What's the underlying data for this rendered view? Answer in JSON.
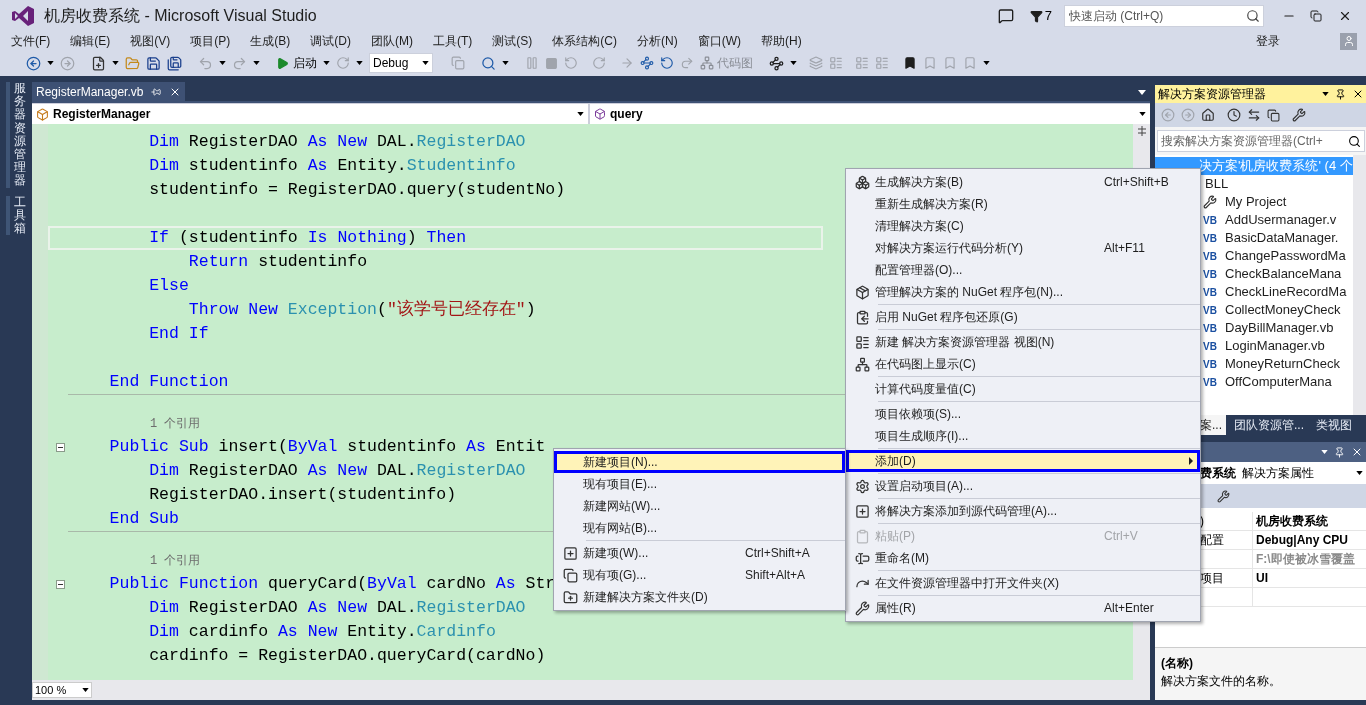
{
  "window": {
    "title": "机房收费系统 - Microsoft Visual Studio",
    "notification_count": "7",
    "quick_launch": {
      "placeholder": "快速启动 (Ctrl+Q)"
    }
  },
  "menu_bar": {
    "items": [
      "文件(F)",
      "编辑(E)",
      "视图(V)",
      "项目(P)",
      "生成(B)",
      "调试(D)",
      "团队(M)",
      "工具(T)",
      "测试(S)",
      "体系结构(C)",
      "分析(N)",
      "窗口(W)",
      "帮助(H)"
    ],
    "sign_in": "登录"
  },
  "toolbar": {
    "start": "启动",
    "configuration": "Debug",
    "code_map": "代码图"
  },
  "side_tabs": [
    "服务器资源管理器",
    "工具箱"
  ],
  "editor": {
    "tabs": [
      {
        "label": "RegisterManager.vb",
        "selected": true
      }
    ],
    "type_selector": "RegisterManager",
    "member_selector": "query",
    "zoom": "100 %",
    "lines": [
      {
        "kind": "code",
        "current": false,
        "fold": false,
        "tokens": [
          {
            "t": "        Dim ",
            "kind": "kw"
          },
          {
            "t": "RegisterDAO ",
            "kind": "p"
          },
          {
            "t": "As New ",
            "kind": "kw"
          },
          {
            "t": "DAL.",
            "kind": "p"
          },
          {
            "t": "RegisterDAO",
            "kind": "ty"
          }
        ]
      },
      {
        "kind": "code",
        "current": false,
        "fold": false,
        "tokens": [
          {
            "t": "        Dim ",
            "kind": "kw"
          },
          {
            "t": "studentinfo ",
            "kind": "p"
          },
          {
            "t": "As ",
            "kind": "kw"
          },
          {
            "t": "Entity.",
            "kind": "p"
          },
          {
            "t": "Studentinfo",
            "kind": "ty"
          }
        ]
      },
      {
        "kind": "code",
        "current": false,
        "fold": false,
        "tokens": [
          {
            "t": "        studentinfo = RegisterDAO.query(studentNo)",
            "kind": "p"
          }
        ]
      },
      {
        "kind": "blank"
      },
      {
        "kind": "code",
        "current": true,
        "fold": false,
        "tokens": [
          {
            "t": "        If ",
            "kind": "kw"
          },
          {
            "t": "(studentinfo ",
            "kind": "p"
          },
          {
            "t": "Is Nothing",
            "kind": "kw"
          },
          {
            "t": ") ",
            "kind": "p"
          },
          {
            "t": "Then",
            "kind": "kw"
          }
        ]
      },
      {
        "kind": "code",
        "current": false,
        "fold": false,
        "tokens": [
          {
            "t": "            Return ",
            "kind": "kw"
          },
          {
            "t": "studentinfo",
            "kind": "p"
          }
        ]
      },
      {
        "kind": "code",
        "current": false,
        "fold": false,
        "tokens": [
          {
            "t": "        Else",
            "kind": "kw"
          }
        ]
      },
      {
        "kind": "code",
        "current": false,
        "fold": false,
        "tokens": [
          {
            "t": "            Throw New ",
            "kind": "kw"
          },
          {
            "t": "Exception",
            "kind": "ty"
          },
          {
            "t": "(",
            "kind": "p"
          },
          {
            "t": "\"该学号已经存在\"",
            "kind": "str"
          },
          {
            "t": ")",
            "kind": "p"
          }
        ]
      },
      {
        "kind": "code",
        "current": false,
        "fold": false,
        "tokens": [
          {
            "t": "        End If",
            "kind": "kw"
          }
        ]
      },
      {
        "kind": "blank"
      },
      {
        "kind": "code",
        "current": false,
        "fold": false,
        "tokens": [
          {
            "t": "    End Function",
            "kind": "kw"
          }
        ]
      },
      {
        "kind": "separator"
      },
      {
        "kind": "lens",
        "text": "1 个引用"
      },
      {
        "kind": "code",
        "current": false,
        "fold": true,
        "tokens": [
          {
            "t": "    Public Sub ",
            "kind": "kw"
          },
          {
            "t": "insert(",
            "kind": "p"
          },
          {
            "t": "ByVal ",
            "kind": "kw"
          },
          {
            "t": "studentinfo ",
            "kind": "p"
          },
          {
            "t": "As ",
            "kind": "kw"
          },
          {
            "t": "Entit",
            "kind": "p"
          }
        ]
      },
      {
        "kind": "code",
        "current": false,
        "fold": false,
        "tokens": [
          {
            "t": "        Dim ",
            "kind": "kw"
          },
          {
            "t": "RegisterDAO ",
            "kind": "p"
          },
          {
            "t": "As New ",
            "kind": "kw"
          },
          {
            "t": "DAL.",
            "kind": "p"
          },
          {
            "t": "RegisterDAO",
            "kind": "ty"
          }
        ]
      },
      {
        "kind": "code",
        "current": false,
        "fold": false,
        "tokens": [
          {
            "t": "        RegisterDAO.insert(studentinfo)",
            "kind": "p"
          }
        ]
      },
      {
        "kind": "code",
        "current": false,
        "fold": false,
        "tokens": [
          {
            "t": "    End Sub",
            "kind": "kw"
          }
        ]
      },
      {
        "kind": "separator"
      },
      {
        "kind": "lens",
        "text": "1 个引用"
      },
      {
        "kind": "code",
        "current": false,
        "fold": true,
        "tokens": [
          {
            "t": "    Public Function ",
            "kind": "kw"
          },
          {
            "t": "queryCard(",
            "kind": "p"
          },
          {
            "t": "ByVal ",
            "kind": "kw"
          },
          {
            "t": "cardNo ",
            "kind": "p"
          },
          {
            "t": "As ",
            "kind": "kw"
          },
          {
            "t": "Str",
            "kind": "p"
          }
        ]
      },
      {
        "kind": "code",
        "current": false,
        "fold": false,
        "tokens": [
          {
            "t": "        Dim ",
            "kind": "kw"
          },
          {
            "t": "RegisterDAO ",
            "kind": "p"
          },
          {
            "t": "As New ",
            "kind": "kw"
          },
          {
            "t": "DAL.",
            "kind": "p"
          },
          {
            "t": "RegisterDAO",
            "kind": "ty"
          }
        ]
      },
      {
        "kind": "code",
        "current": false,
        "fold": false,
        "tokens": [
          {
            "t": "        Dim ",
            "kind": "kw"
          },
          {
            "t": "cardinfo ",
            "kind": "p"
          },
          {
            "t": "As New ",
            "kind": "kw"
          },
          {
            "t": "Entity.",
            "kind": "p"
          },
          {
            "t": "Cardinfo",
            "kind": "ty"
          }
        ]
      },
      {
        "kind": "code",
        "current": false,
        "fold": false,
        "tokens": [
          {
            "t": "        cardinfo = RegisterDAO.queryCard(cardNo)",
            "kind": "p"
          }
        ]
      }
    ]
  },
  "context_menu": {
    "items": [
      {
        "kind": "item",
        "label": "生成解决方案(B)",
        "shortcut": "Ctrl+Shift+B",
        "disabled": false,
        "selected": false,
        "submenu": false
      },
      {
        "kind": "item",
        "label": "重新生成解决方案(R)",
        "disabled": false,
        "selected": false,
        "submenu": false
      },
      {
        "kind": "item",
        "label": "清理解决方案(C)",
        "disabled": false,
        "selected": false,
        "submenu": false
      },
      {
        "kind": "item",
        "label": "对解决方案运行代码分析(Y)",
        "shortcut": "Alt+F11",
        "disabled": false,
        "selected": false,
        "submenu": false
      },
      {
        "kind": "item",
        "label": "配置管理器(O)...",
        "disabled": false,
        "selected": false,
        "submenu": false
      },
      {
        "kind": "item",
        "label": "管理解决方案的 NuGet 程序包(N)...",
        "disabled": false,
        "selected": false,
        "submenu": false
      },
      {
        "kind": "separator"
      },
      {
        "kind": "item",
        "label": "启用 NuGet 程序包还原(G)",
        "disabled": false,
        "selected": false,
        "submenu": false
      },
      {
        "kind": "separator"
      },
      {
        "kind": "item",
        "label": "新建 解决方案资源管理器 视图(N)",
        "disabled": false,
        "selected": false,
        "submenu": false
      },
      {
        "kind": "item",
        "label": "在代码图上显示(C)",
        "disabled": false,
        "selected": false,
        "submenu": false
      },
      {
        "kind": "separator"
      },
      {
        "kind": "item",
        "label": "计算代码度量值(C)",
        "disabled": false,
        "selected": false,
        "submenu": false
      },
      {
        "kind": "separator"
      },
      {
        "kind": "item",
        "label": "项目依赖项(S)...",
        "disabled": false,
        "selected": false,
        "submenu": false
      },
      {
        "kind": "item",
        "label": "项目生成顺序(I)...",
        "disabled": false,
        "selected": false,
        "submenu": false
      },
      {
        "kind": "separator"
      },
      {
        "kind": "item",
        "label": "添加(D)",
        "disabled": false,
        "selected": true,
        "submenu": true
      },
      {
        "kind": "separator"
      },
      {
        "kind": "item",
        "label": "设置启动项目(A)...",
        "disabled": false,
        "selected": false,
        "submenu": false
      },
      {
        "kind": "separator"
      },
      {
        "kind": "item",
        "label": "将解决方案添加到源代码管理(A)...",
        "disabled": false,
        "selected": false,
        "submenu": false
      },
      {
        "kind": "separator"
      },
      {
        "kind": "item",
        "label": "粘贴(P)",
        "shortcut": "Ctrl+V",
        "disabled": true,
        "selected": false,
        "submenu": false
      },
      {
        "kind": "item",
        "label": "重命名(M)",
        "disabled": false,
        "selected": false,
        "submenu": false
      },
      {
        "kind": "separator"
      },
      {
        "kind": "item",
        "label": "在文件资源管理器中打开文件夹(X)",
        "disabled": false,
        "selected": false,
        "submenu": false
      },
      {
        "kind": "separator"
      },
      {
        "kind": "item",
        "label": "属性(R)",
        "shortcut": "Alt+Enter",
        "disabled": false,
        "selected": false,
        "submenu": false
      }
    ]
  },
  "add_submenu": {
    "items": [
      {
        "kind": "item",
        "label": "新建项目(N)...",
        "disabled": false,
        "selected": true,
        "submenu": false
      },
      {
        "kind": "item",
        "label": "现有项目(E)...",
        "disabled": false,
        "selected": false,
        "submenu": false
      },
      {
        "kind": "item",
        "label": "新建网站(W)...",
        "disabled": false,
        "selected": false,
        "submenu": false
      },
      {
        "kind": "item",
        "label": "现有网站(B)...",
        "disabled": false,
        "selected": false,
        "submenu": false
      },
      {
        "kind": "separator"
      },
      {
        "kind": "item",
        "label": "新建项(W)...",
        "shortcut": "Ctrl+Shift+A",
        "disabled": false,
        "selected": false,
        "submenu": false
      },
      {
        "kind": "item",
        "label": "现有项(G)...",
        "shortcut": "Shift+Alt+A",
        "disabled": false,
        "selected": false,
        "submenu": false
      },
      {
        "kind": "item",
        "label": "新建解决方案文件夹(D)",
        "disabled": false,
        "selected": false,
        "submenu": false
      }
    ]
  },
  "solution_explorer": {
    "title": "解决方案资源管理器",
    "search": {
      "placeholder": "搜索解决方案资源管理器(Ctrl+"
    },
    "tree": [
      {
        "label": "决方案'机房收费系统' (4 个",
        "selected": true,
        "children": [
          {
            "label": "BLL",
            "selected": false,
            "children": [
              {
                "label": "My Project",
                "kind": "settings",
                "selected": false
              },
              {
                "label": "AddUsermanager.v",
                "kind": "file",
                "badge": "VB",
                "selected": false
              },
              {
                "label": "BasicDataManager.",
                "kind": "file",
                "badge": "VB",
                "selected": false
              },
              {
                "label": "ChangePasswordMa",
                "kind": "file",
                "badge": "VB",
                "selected": false
              },
              {
                "label": "CheckBalanceMana",
                "kind": "file",
                "badge": "VB",
                "selected": false
              },
              {
                "label": "CheckLineRecordMa",
                "kind": "file",
                "badge": "VB",
                "selected": false
              },
              {
                "label": "CollectMoneyCheck",
                "kind": "file",
                "badge": "VB",
                "selected": false
              },
              {
                "label": "DayBillManager.vb",
                "kind": "file",
                "badge": "VB",
                "selected": false
              },
              {
                "label": "LoginManager.vb",
                "kind": "file",
                "badge": "VB",
                "selected": false
              },
              {
                "label": "MoneyReturnCheck",
                "kind": "file",
                "badge": "VB",
                "selected": false
              },
              {
                "label": "OffComputerMana",
                "kind": "file",
                "badge": "VB",
                "selected": false
              }
            ]
          }
        ]
      }
    ],
    "tabs": [
      {
        "label": "案...",
        "selected": true
      },
      {
        "label": "团队资源管...",
        "selected": false
      },
      {
        "label": "类视图",
        "selected": false
      }
    ]
  },
  "properties": {
    "object": "费系统",
    "object_type": "解决方案属性",
    "rows": [
      {
        "name": ")",
        "value": "机房收费系统",
        "readonly": false
      },
      {
        "name": "配置",
        "value": "Debug|Any CPU",
        "readonly": false
      },
      {
        "value": "F:\\即使被冰雪覆盖",
        "readonly": true
      },
      {
        "name": "项目",
        "value": "UI",
        "readonly": false
      }
    ],
    "description": {
      "title": "(名称)",
      "text": "解决方案文件的名称。"
    }
  }
}
